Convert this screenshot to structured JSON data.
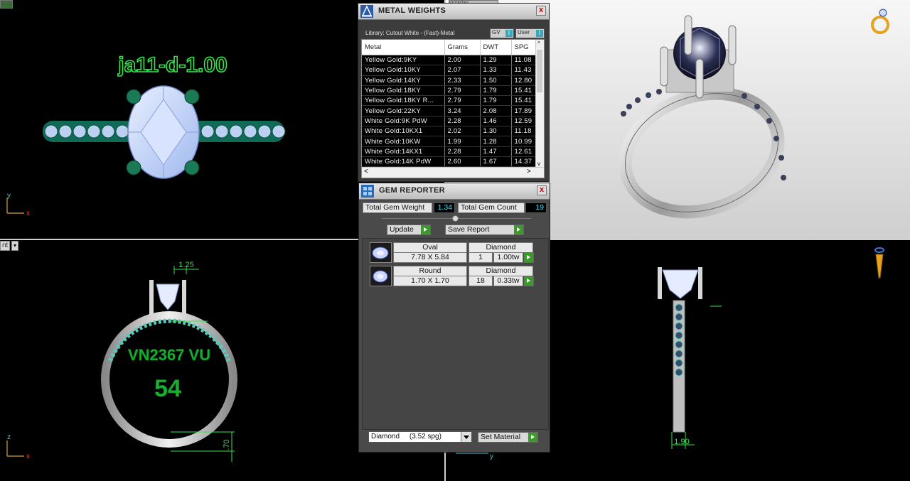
{
  "viewports": {
    "top_left": {
      "label": "ja11-d-1.00",
      "axis_y": "y",
      "axis_x": "x"
    },
    "bottom_left": {
      "label_line1": "VN2367 VU",
      "label_line2": "54",
      "view_name": "nt",
      "dim_top": "1.25",
      "dim_right": ".70",
      "axis_y": "z",
      "axis_x": "x"
    },
    "bottom_right": {
      "dim_bottom": "1.90",
      "axis_y": "y"
    }
  },
  "metal_weights": {
    "title": "METAL WEIGHTS",
    "library": "Library: Cutout White - (Fast)-Metal",
    "gv_label": "GV",
    "user_label": "User",
    "check_mark": "I",
    "close": "x",
    "hidden_tab": "Properties",
    "scroll_left": "<",
    "scroll_right": ">",
    "scroll_up": "^",
    "scroll_down": "v",
    "columns": [
      "Metal",
      "Grams",
      "DWT",
      "SPG"
    ],
    "rows": [
      [
        "Yellow Gold:9KY",
        "2.00",
        "1.29",
        "11.08"
      ],
      [
        "Yellow Gold:10KY",
        "2.07",
        "1.33",
        "11.43"
      ],
      [
        "Yellow Gold:14KY",
        "2.33",
        "1.50",
        "12.80"
      ],
      [
        "Yellow Gold:18KY",
        "2.79",
        "1.79",
        "15.41"
      ],
      [
        "Yellow Gold:18KY R...",
        "2.79",
        "1.79",
        "15.41"
      ],
      [
        "Yellow Gold:22KY",
        "3.24",
        "2.08",
        "17.89"
      ],
      [
        "White Gold:9K PdW",
        "2.28",
        "1.46",
        "12.59"
      ],
      [
        "White Gold:10KX1",
        "2.02",
        "1.30",
        "11.18"
      ],
      [
        "White Gold:10KW",
        "1.99",
        "1.28",
        "10.99"
      ],
      [
        "White Gold:14KX1",
        "2.28",
        "1.47",
        "12.61"
      ],
      [
        "White Gold:14K PdW",
        "2.60",
        "1.67",
        "14.37"
      ]
    ]
  },
  "gem_reporter": {
    "title": "GEM REPORTER",
    "close": "x",
    "total_weight_label": "Total Gem Weight",
    "total_weight_value": "1.34",
    "total_count_label": "Total Gem Count",
    "total_count_value": "19",
    "update_label": "Update",
    "save_report_label": "Save Report",
    "gems": [
      {
        "shape": "Oval",
        "material": "Diamond",
        "size": "7.78 X 5.84",
        "count": "1",
        "weight": "1.00tw"
      },
      {
        "shape": "Round",
        "material": "Diamond",
        "size": "1.70 X 1.70",
        "count": "18",
        "weight": "0.33tw"
      }
    ],
    "material_select": "Diamond     (3.52 spg)",
    "set_material_label": "Set Material"
  }
}
